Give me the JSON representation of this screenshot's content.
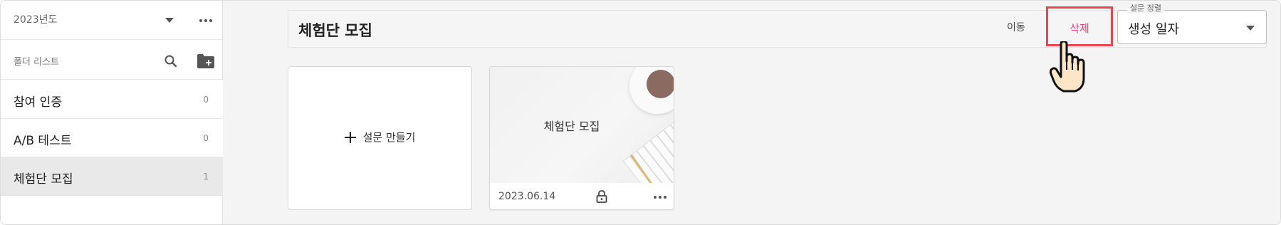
{
  "sidebar": {
    "year": "2023년도",
    "folder_list_label": "폴더 리스트",
    "items": [
      {
        "label": "참여 인증",
        "count": "0"
      },
      {
        "label": "A/B 테스트",
        "count": "0"
      },
      {
        "label": "체험단 모집",
        "count": "1"
      }
    ],
    "active_index": 2
  },
  "header": {
    "title": "체험단 모집",
    "move_label": "이동",
    "delete_label": "삭제",
    "sort_legend": "설문 정렬",
    "sort_value": "생성 일자"
  },
  "main": {
    "create_label": "설문 만들기",
    "cards": [
      {
        "title": "체험단 모집",
        "date": "2023.06.14"
      }
    ]
  },
  "colors": {
    "highlight_border": "#e8484d",
    "delete_text": "#e0407c",
    "active_item_bg": "#e9e9e9"
  },
  "icons": [
    "chevron-down-icon",
    "more-icon",
    "search-icon",
    "add-folder-icon",
    "plus-icon",
    "lock-icon",
    "pointing-hand-icon"
  ]
}
